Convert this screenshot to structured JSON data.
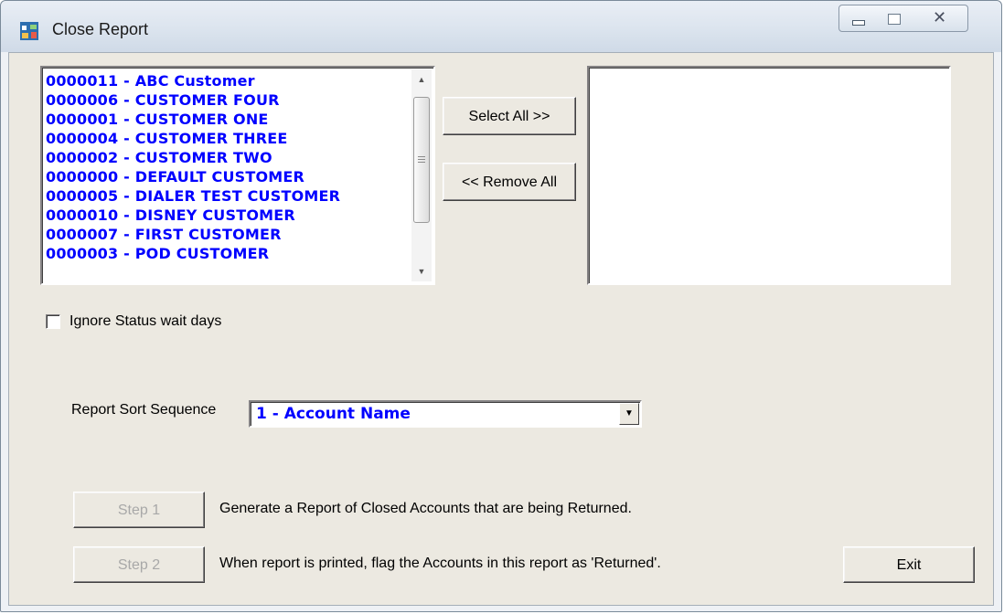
{
  "window": {
    "title": "Close Report",
    "app_icon": "report-icon",
    "caption_buttons": [
      "minimize-icon",
      "maximize-icon",
      "close-icon"
    ]
  },
  "customer_list": {
    "items": [
      "0000011 - ABC Customer",
      "0000006 - CUSTOMER FOUR",
      "0000001 - CUSTOMER ONE",
      "0000004 - CUSTOMER THREE",
      "0000002 - CUSTOMER TWO",
      "0000000 - DEFAULT CUSTOMER",
      "0000005 - DIALER TEST CUSTOMER",
      "0000010 - DISNEY CUSTOMER",
      "0000007 - FIRST CUSTOMER",
      "0000003 - POD CUSTOMER"
    ]
  },
  "selected_list": {
    "items": []
  },
  "buttons": {
    "select_all": "Select All >>",
    "remove_all": "<< Remove All",
    "step1": "Step 1",
    "step2": "Step 2",
    "exit": "Exit"
  },
  "options": {
    "ignore_status_label": "Ignore Status wait days",
    "ignore_status_checked": false
  },
  "sort": {
    "label": "Report Sort Sequence",
    "value": "1 - Account Name"
  },
  "steps": {
    "step1_desc": "Generate a Report of Closed Accounts that are being Returned.",
    "step2_desc": "When report is printed, flag the Accounts in this report as 'Returned'."
  },
  "colors": {
    "list_text": "#0000ff",
    "dialog_bg": "#ece9e1",
    "disabled_text": "#a8a8a8"
  }
}
